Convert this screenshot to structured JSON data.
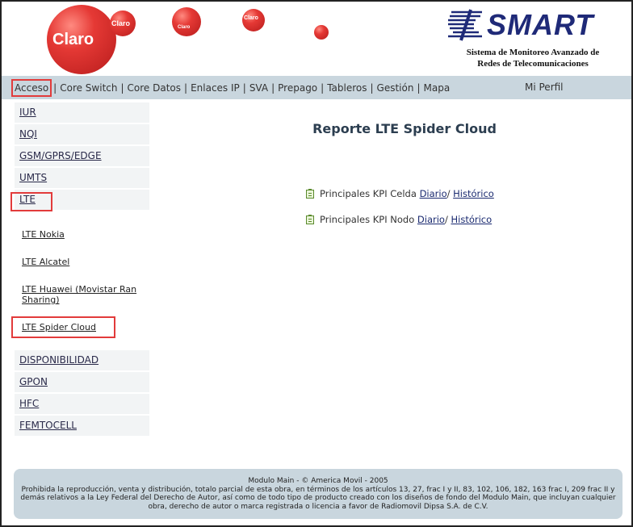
{
  "header": {
    "logo_text": "Claro",
    "ball_texts": [
      "Claro",
      "Claro",
      "Claro"
    ],
    "brand": "SMART",
    "subtitle_line1": "Sistema de Monitoreo Avanzado de",
    "subtitle_line2": "Redes de Telecomunicaciones"
  },
  "nav": {
    "items": [
      "Acceso",
      "Core Switch",
      "Core Datos",
      "Enlaces IP",
      "SVA",
      "Prepago",
      "Tableros",
      "Gestión",
      "Mapa"
    ],
    "separator": "|",
    "profile": "Mi Perfil",
    "highlighted": "Acceso"
  },
  "sidebar": {
    "items": [
      "IUR",
      "NQI",
      "GSM/GPRS/EDGE",
      "UMTS",
      "LTE",
      "DISPONIBILIDAD",
      "GPON",
      "HFC",
      "FEMTOCELL"
    ],
    "lte_subitems": [
      "LTE Nokia",
      "LTE Alcatel",
      "LTE Huawei (Movistar Ran Sharing)",
      "LTE Spider Cloud"
    ],
    "highlighted": [
      "LTE",
      "LTE Spider Cloud"
    ]
  },
  "main": {
    "title": "Reporte LTE Spider Cloud",
    "rows": [
      {
        "label": "Principales KPI Celda",
        "link1": "Diario",
        "sep": "/",
        "link2": "Histórico"
      },
      {
        "label": "Principales KPI Nodo",
        "link1": "Diario",
        "sep": "/",
        "link2": "Histórico"
      }
    ]
  },
  "footer": {
    "line1": "Modulo Main - © America Movil - 2005",
    "line2": "Prohibida la reproducción, venta y distribución, totalo parcial de esta obra, en términos de los artículos 13, 27, frac I y II, 83, 102, 106, 182, 163 frac I, 209 frac II y demás relativos a la Ley Federal del Derecho de Autor, así como de todo tipo de producto creado con los diseños de fondo del Modulo Main, que incluyan cualquier obra, derecho de autor o marca registrada o licencia a favor de Radiomovil Dipsa S.A. de C.V."
  },
  "colors": {
    "brand_red": "#e53935",
    "brand_blue": "#1f2a78",
    "bar_bg": "#c9d6de",
    "highlight_box": "#e23b3b"
  }
}
